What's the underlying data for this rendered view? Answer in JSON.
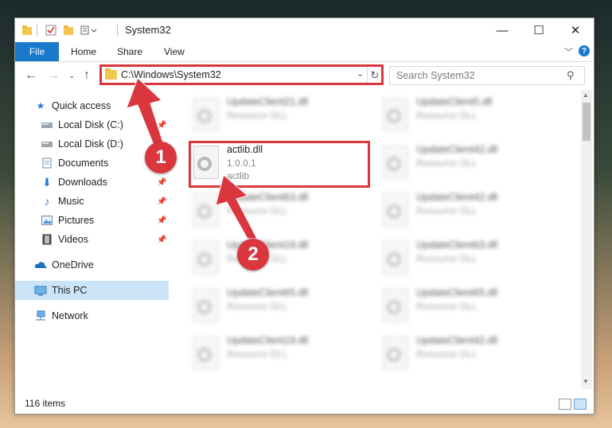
{
  "window": {
    "title": "System32",
    "minimize_glyph": "—",
    "maximize_glyph": "☐",
    "close_glyph": "✕"
  },
  "ribbon": {
    "tabs": [
      "File",
      "Home",
      "Share",
      "View"
    ],
    "help": "?"
  },
  "address": {
    "path": "C:\\Windows\\System32",
    "search_placeholder": "Search System32"
  },
  "nav": {
    "items": [
      {
        "label": "Quick access",
        "icon": "star-icon"
      },
      {
        "label": "Local Disk (C:)",
        "icon": "drive-icon"
      },
      {
        "label": "Local Disk (D:)",
        "icon": "drive-icon"
      },
      {
        "label": "Documents",
        "icon": "documents-icon"
      },
      {
        "label": "Downloads",
        "icon": "download-icon"
      },
      {
        "label": "Music",
        "icon": "music-icon"
      },
      {
        "label": "Pictures",
        "icon": "pictures-icon"
      },
      {
        "label": "Videos",
        "icon": "videos-icon"
      },
      {
        "label": "OneDrive",
        "icon": "cloud-icon"
      },
      {
        "label": "This PC",
        "icon": "computer-icon"
      },
      {
        "label": "Network",
        "icon": "network-icon"
      }
    ]
  },
  "files": {
    "left": [
      {
        "name": "UpdateClient21.dll",
        "sub": "Resource DLL"
      },
      {
        "name": "actlib.dll",
        "sub": "1.0.0.1",
        "sub2": "actlib"
      },
      {
        "name": "UpdateClient63.dll",
        "sub": "Resource DLL"
      },
      {
        "name": "UpdateClient19.dll",
        "sub": "Resource DLL"
      },
      {
        "name": "UpdateClient65.dll",
        "sub": "Resource DLL"
      },
      {
        "name": "UpdateClient19.dll",
        "sub": "Resource DLL"
      }
    ],
    "right": [
      {
        "name": "UpdateClient5.dll",
        "sub": "Resource DLL"
      },
      {
        "name": "UpdateClient42.dll",
        "sub": "Resource DLL"
      },
      {
        "name": "UpdateClient42.dll",
        "sub": "Resource DLL"
      },
      {
        "name": "UpdateClient63.dll",
        "sub": "Resource DLL"
      },
      {
        "name": "UpdateClient65.dll",
        "sub": "Resource DLL"
      },
      {
        "name": "UpdateClient42.dll",
        "sub": "Resource DLL"
      }
    ]
  },
  "status": {
    "item_count": "116 items"
  },
  "annotations": {
    "step1": "1",
    "step2": "2",
    "color": "#d9363e"
  }
}
